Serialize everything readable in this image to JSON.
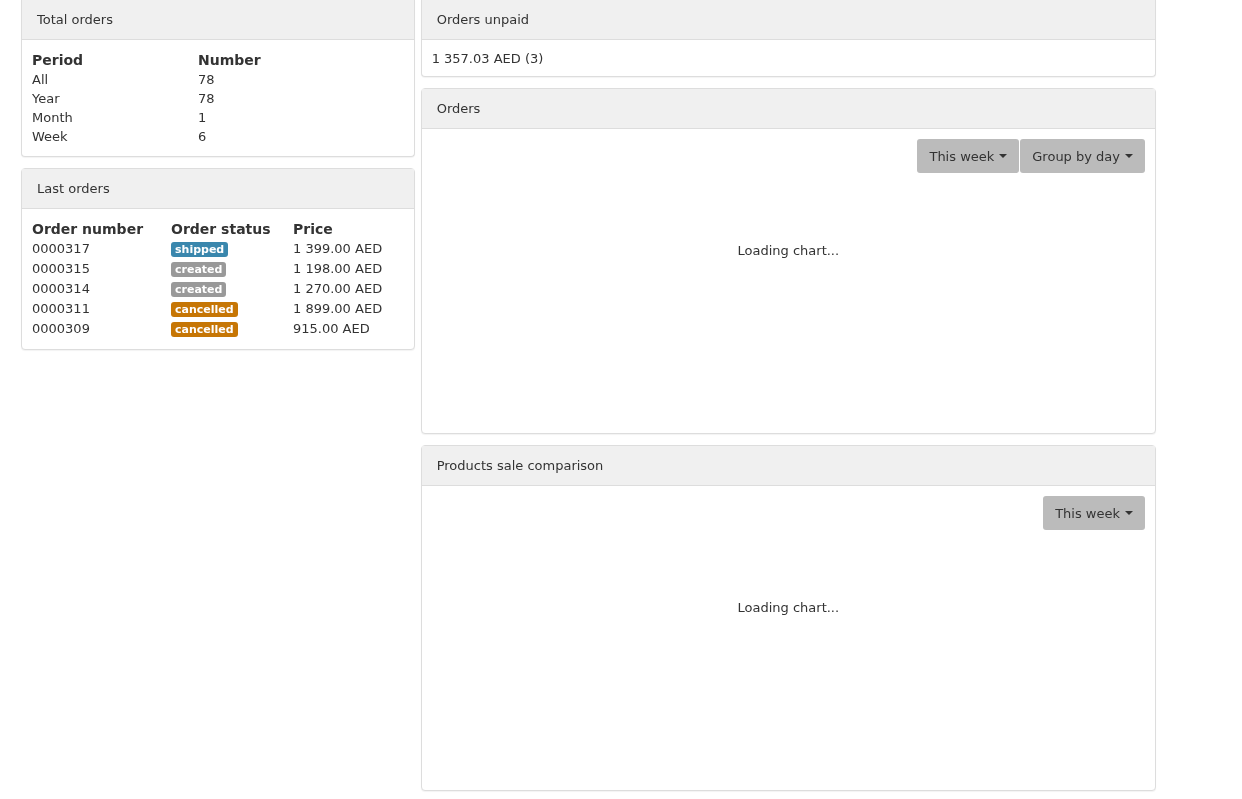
{
  "total_orders": {
    "title": "Total orders",
    "columns": [
      "Period",
      "Number"
    ],
    "rows": [
      [
        "All",
        "78"
      ],
      [
        "Year",
        "78"
      ],
      [
        "Month",
        "1"
      ],
      [
        "Week",
        "6"
      ]
    ]
  },
  "last_orders": {
    "title": "Last orders",
    "columns": [
      "Order number",
      "Order status",
      "Price"
    ],
    "rows": [
      {
        "number": "0000317",
        "status": "shipped",
        "color": "#3a87ad",
        "price": "1 399.00 AED"
      },
      {
        "number": "0000315",
        "status": "created",
        "color": "#999999",
        "price": "1 198.00 AED"
      },
      {
        "number": "0000314",
        "status": "created",
        "color": "#999999",
        "price": "1 270.00 AED"
      },
      {
        "number": "0000311",
        "status": "cancelled",
        "color": "#c67605",
        "price": "1 899.00 AED"
      },
      {
        "number": "0000309",
        "status": "cancelled",
        "color": "#c67605",
        "price": "915.00 AED"
      }
    ]
  },
  "orders_unpaid": {
    "title": "Orders unpaid",
    "value": "1 357.03 AED (3)"
  },
  "chart_panels": [
    {
      "title": "Orders",
      "dropdowns": [
        "This week",
        "Group by day"
      ],
      "message": "Loading chart..."
    },
    {
      "title": "Products sale comparison",
      "dropdowns": [
        "This week"
      ],
      "message": "Loading chart..."
    }
  ]
}
